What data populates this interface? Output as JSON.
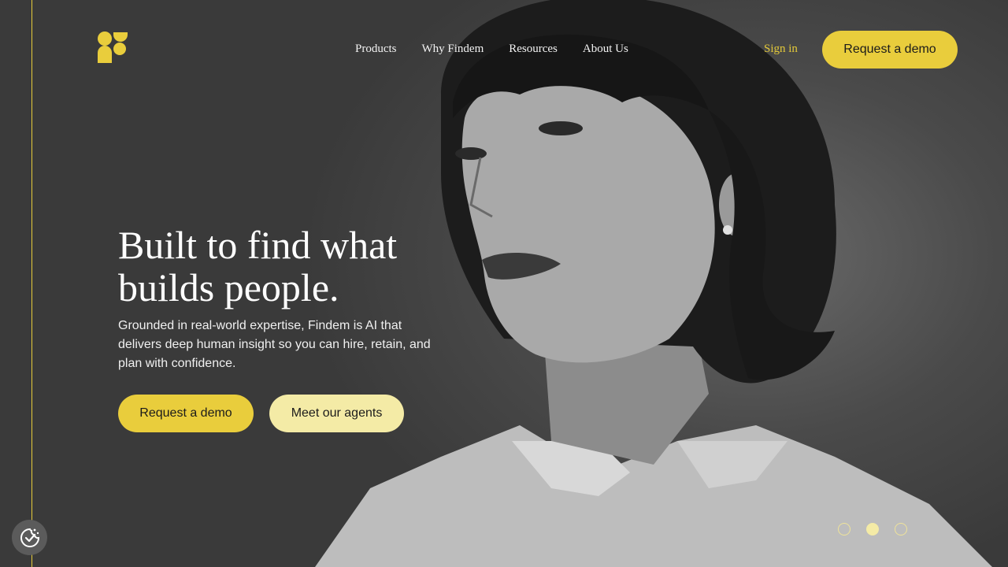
{
  "brand": {
    "name": "Findem",
    "accent_color": "#e9cd3c",
    "secondary_color": "#f4eba6"
  },
  "nav": {
    "items": [
      "Products",
      "Why Findem",
      "Resources",
      "About Us"
    ],
    "sign_in": "Sign in",
    "cta": "Request a demo"
  },
  "hero": {
    "headline": "Built to find what builds people.",
    "subtext": "Grounded in real-world expertise, Findem is AI that delivers deep human insight so you can hire, retain, and plan with confidence.",
    "primary_cta": "Request a demo",
    "secondary_cta": "Meet our agents",
    "image": "black-and-white portrait of a woman with short bob haircut"
  },
  "carousel": {
    "count": 3,
    "active_index": 1
  },
  "icons": {
    "logo": "findem-logo-icon",
    "cookie": "cookie-consent-icon"
  }
}
